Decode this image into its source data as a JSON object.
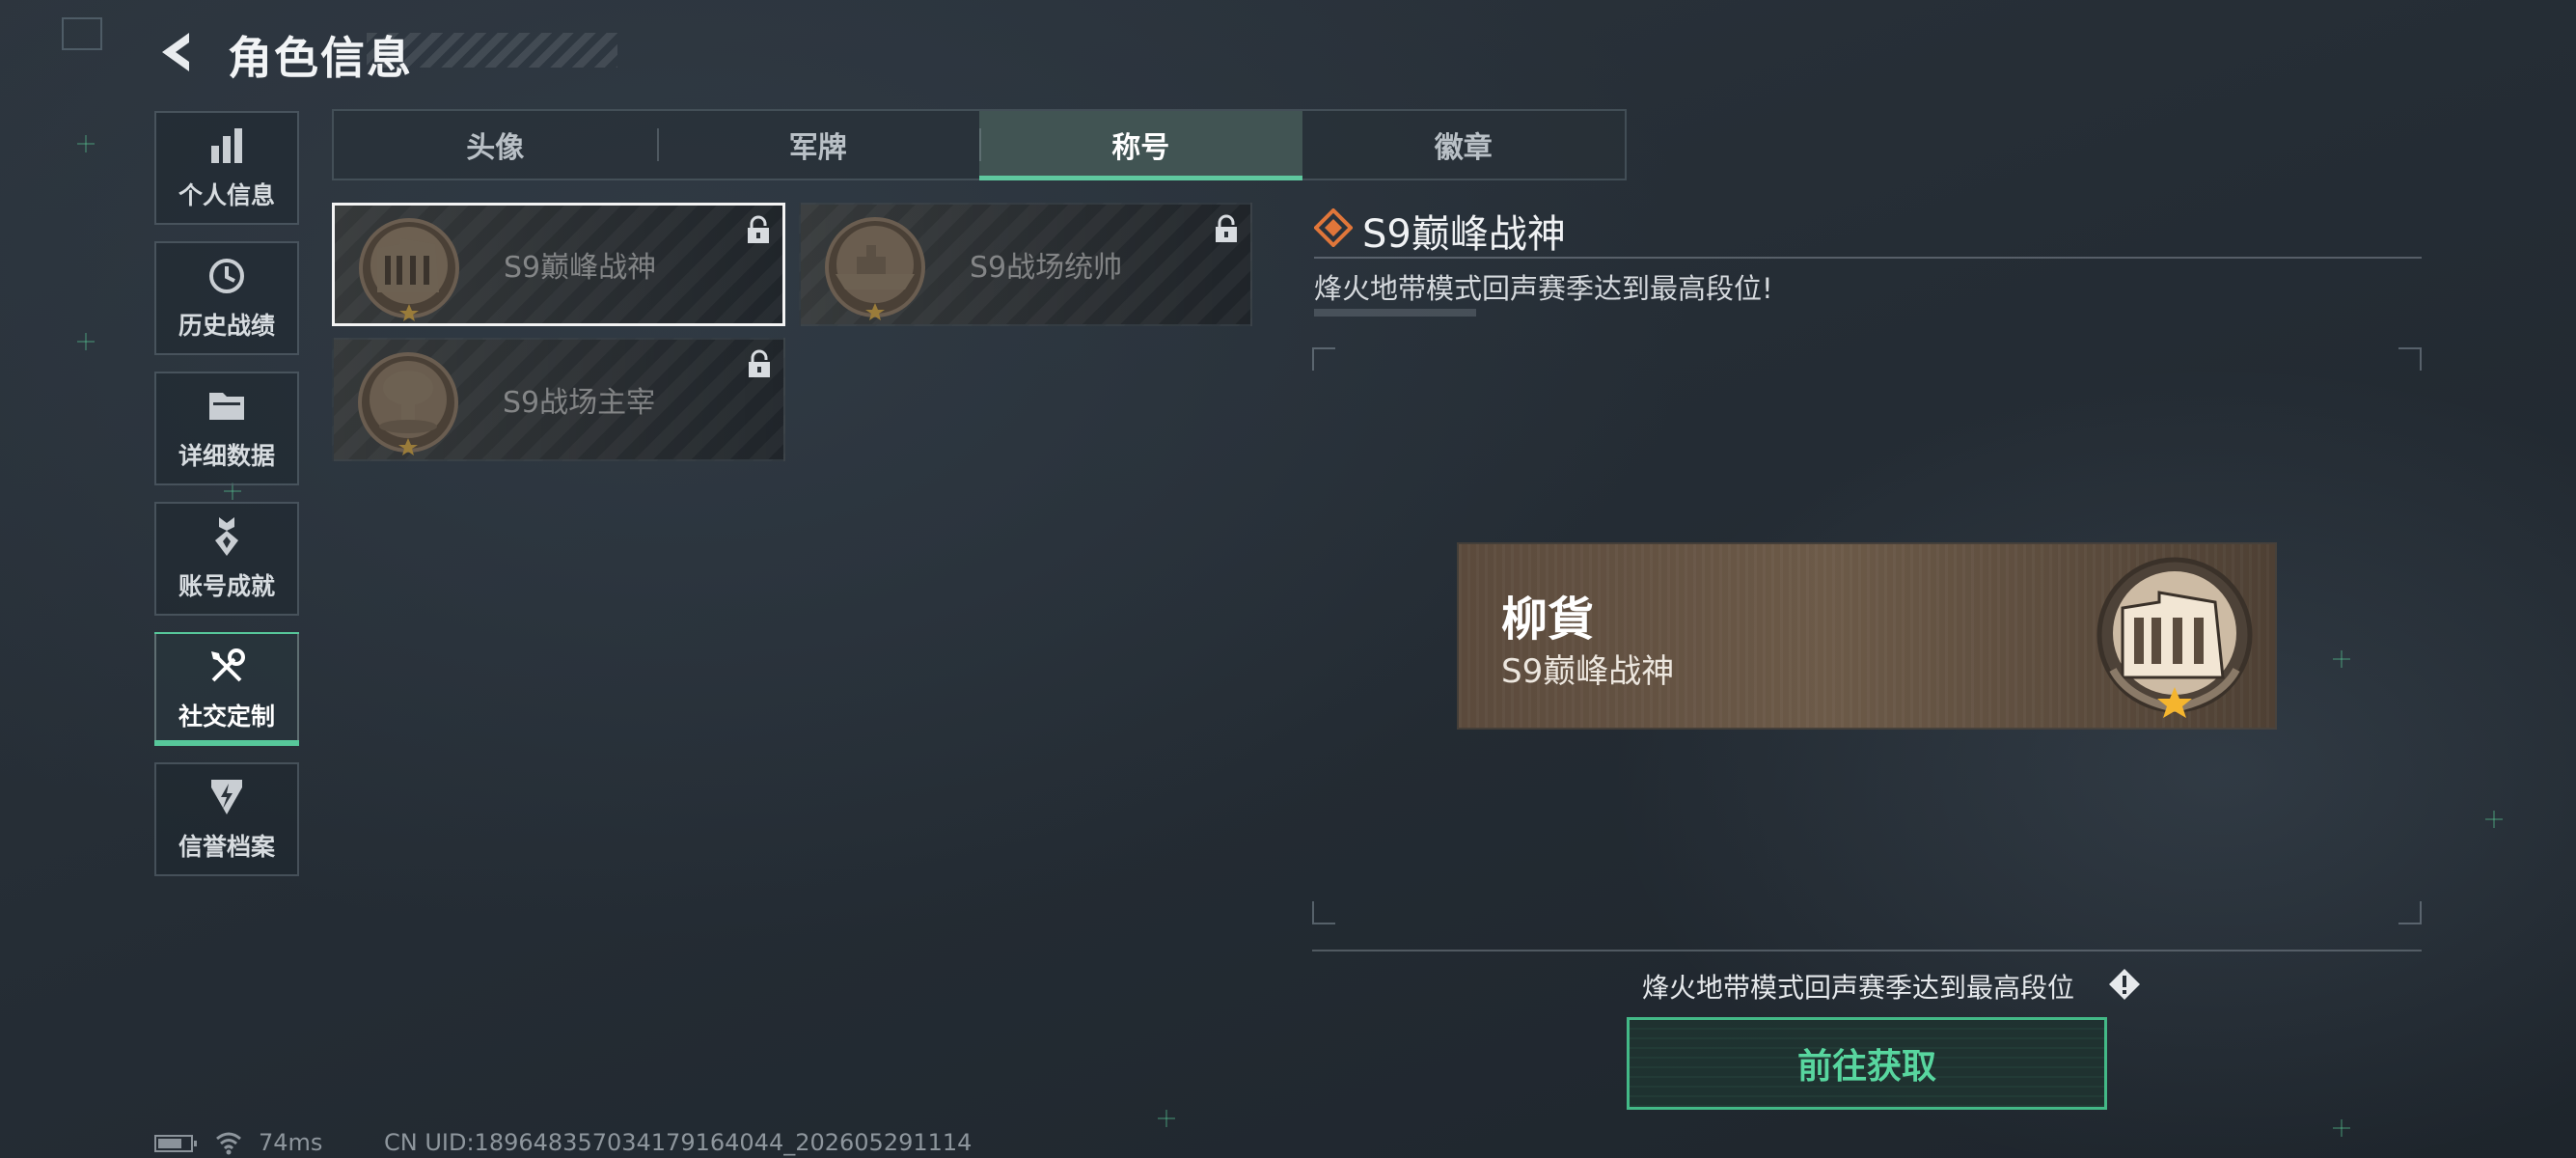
{
  "header": {
    "title": "角色信息"
  },
  "sidebar": {
    "items": [
      {
        "label": "个人信息",
        "icon": "bar-chart-icon"
      },
      {
        "label": "历史战绩",
        "icon": "clock-icon"
      },
      {
        "label": "详细数据",
        "icon": "folder-icon"
      },
      {
        "label": "账号成就",
        "icon": "medal-icon"
      },
      {
        "label": "社交定制",
        "icon": "tools-icon",
        "active": true
      },
      {
        "label": "信誉档案",
        "icon": "shield-icon"
      }
    ]
  },
  "tabs": [
    {
      "label": "头像"
    },
    {
      "label": "军牌"
    },
    {
      "label": "称号",
      "active": true
    },
    {
      "label": "徽章"
    }
  ],
  "titles": [
    {
      "name": "S9巅峰战神",
      "locked": true,
      "selected": true,
      "medal": "building-medal"
    },
    {
      "name": "S9战场统帅",
      "locked": true,
      "selected": false,
      "medal": "ship-medal"
    },
    {
      "name": "S9战场主宰",
      "locked": true,
      "selected": false,
      "medal": "explosion-medal"
    }
  ],
  "detail": {
    "title": "S9巅峰战神",
    "description": "烽火地带模式回声赛季达到最高段位!",
    "preview": {
      "player_name": "柳貨",
      "title": "S9巅峰战神"
    },
    "requirement": "烽火地带模式回声赛季达到最高段位",
    "button_label": "前往获取"
  },
  "status": {
    "battery_fraction": 0.75,
    "ping": "74ms",
    "uid": "CN UID:18964835703417916404​4_202605291114"
  },
  "colors": {
    "accent": "#57c79a",
    "button_text": "#58d69f",
    "diamond": "#e0763a"
  }
}
